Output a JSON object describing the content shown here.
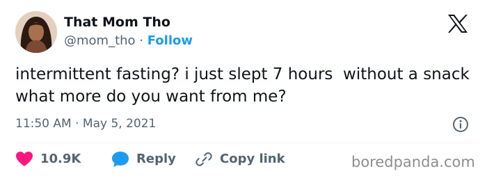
{
  "author": {
    "display_name": "That Mom Tho",
    "handle": "@mom_tho",
    "separator": " · ",
    "follow_label": "Follow"
  },
  "platform_icon": "x-logo-icon",
  "tweet": {
    "text": "intermittent fasting? i just slept 7 hours  without a snack what more do you want from me?",
    "timestamp": "11:50 AM · May 5, 2021"
  },
  "actions": {
    "like": {
      "icon": "heart-icon",
      "count": "10.9K",
      "color": "#f91880"
    },
    "reply": {
      "icon": "speech-bubble-icon",
      "label": "Reply",
      "color": "#1d9bf0"
    },
    "copy_link": {
      "icon": "link-icon",
      "label": "Copy link"
    }
  },
  "watermark": "boredpanda.com",
  "colors": {
    "text": "#0f1419",
    "secondary": "#536471",
    "accent": "#1d9bf0",
    "like": "#f91880"
  }
}
